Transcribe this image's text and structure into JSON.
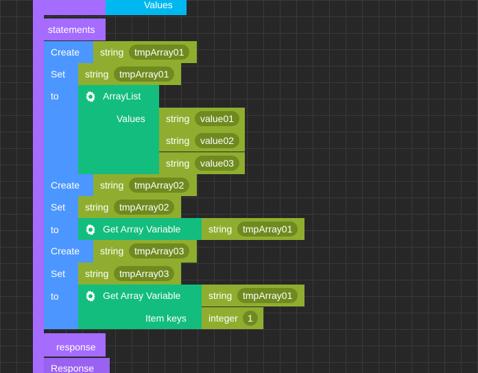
{
  "top_block": {
    "values_label": "Values",
    "statements_label": "statements"
  },
  "blocks": [
    {
      "kind": "create",
      "keyword": "Create",
      "type": "string",
      "name": "tmpArray01"
    },
    {
      "kind": "set",
      "keyword": "Set",
      "type": "string",
      "name": "tmpArray01",
      "to_label": "to",
      "value": {
        "block": "ArrayList",
        "values_label": "Values",
        "items": [
          {
            "type": "string",
            "value": "value01"
          },
          {
            "type": "string",
            "value": "value02"
          },
          {
            "type": "string",
            "value": "value03"
          }
        ]
      }
    },
    {
      "kind": "create",
      "keyword": "Create",
      "type": "string",
      "name": "tmpArray02"
    },
    {
      "kind": "set",
      "keyword": "Set",
      "type": "string",
      "name": "tmpArray02",
      "to_label": "to",
      "value": {
        "block": "Get Array Variable",
        "arg_type": "string",
        "arg_name": "tmpArray01"
      }
    },
    {
      "kind": "create",
      "keyword": "Create",
      "type": "string",
      "name": "tmpArray03"
    },
    {
      "kind": "set",
      "keyword": "Set",
      "type": "string",
      "name": "tmpArray03",
      "to_label": "to",
      "value": {
        "block": "Get Array Variable",
        "arg_type": "string",
        "arg_name": "tmpArray01",
        "item_keys_label": "Item keys",
        "item_keys_type": "integer",
        "item_keys_value": "1"
      }
    }
  ],
  "bottom": {
    "response_label": "response",
    "response_block_label": "Response"
  },
  "colors": {
    "procedure": "#a66bff",
    "variables": "#4c97ff",
    "array": "#13bd7d",
    "string": "#8fae2f",
    "values_block": "#00b8f0",
    "pill": "#6f8a1f"
  },
  "icons": {
    "arraylist": "gear-icon",
    "get_array_variable": "gear-icon"
  }
}
